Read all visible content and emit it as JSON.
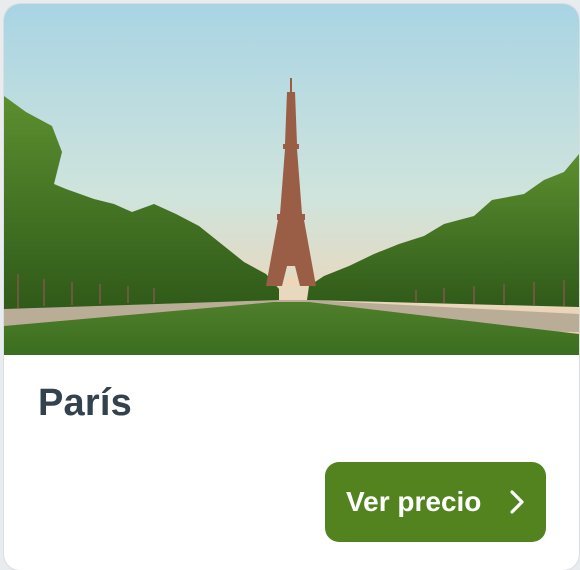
{
  "card": {
    "image": {
      "subject": "eiffel-tower-champ-de-mars"
    },
    "title": "París",
    "button": {
      "label": "Ver precio",
      "icon": "chevron-right-icon"
    }
  },
  "colors": {
    "accent": "#52831f",
    "title": "#33424f",
    "background": "#ffffff"
  }
}
